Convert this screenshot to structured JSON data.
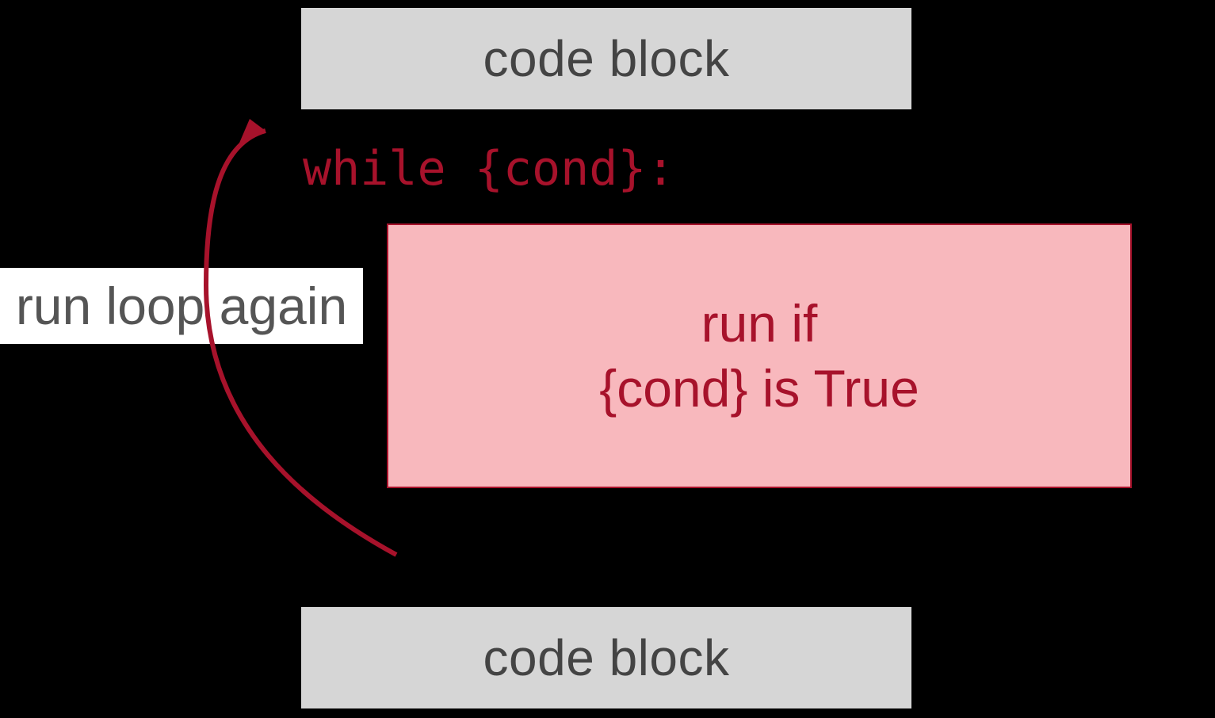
{
  "blocks": {
    "top": "code block",
    "bottom": "code block"
  },
  "while_label": "while {cond}:",
  "loop_body": {
    "line1": "run if",
    "line2": "{cond} is True"
  },
  "loop_again": "run loop again",
  "colors": {
    "accent": "#a7122b",
    "pink_fill": "#f8b8bd",
    "gray_fill": "#d6d6d6"
  }
}
